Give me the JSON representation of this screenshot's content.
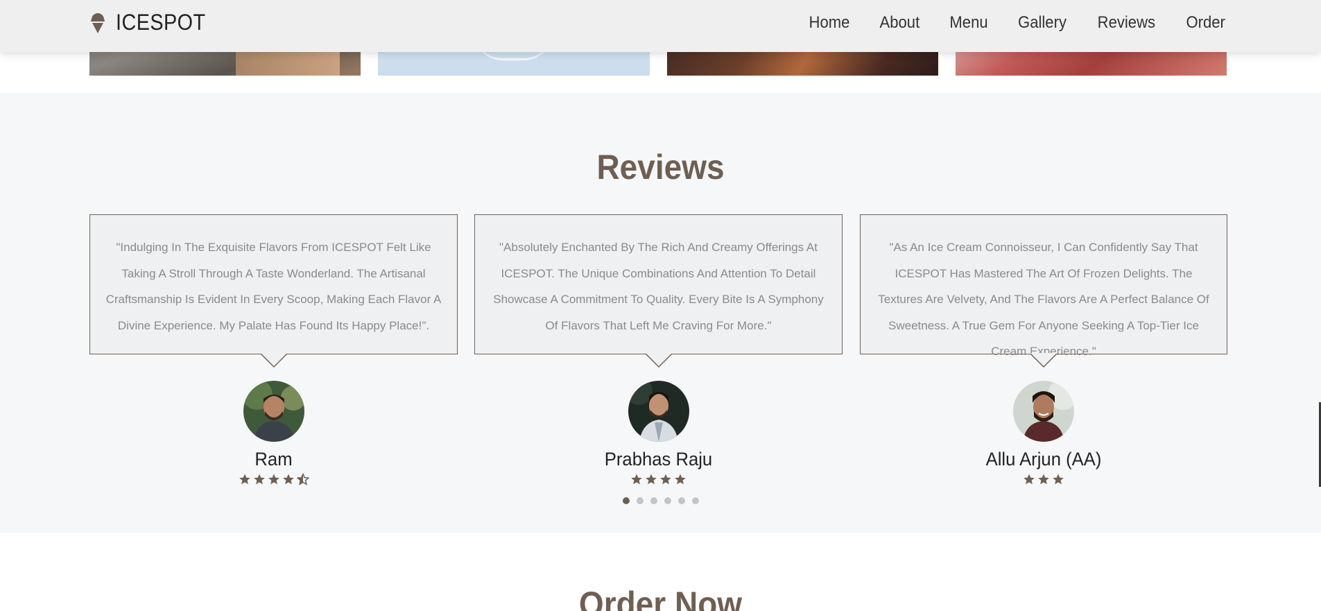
{
  "brand": {
    "name": "ICESPOT",
    "logo_icon": "ice-cream-icon"
  },
  "nav": {
    "items": [
      {
        "label": "Home"
      },
      {
        "label": "About"
      },
      {
        "label": "Menu"
      },
      {
        "label": "Gallery"
      },
      {
        "label": "Reviews"
      },
      {
        "label": "Order"
      }
    ]
  },
  "reviews": {
    "title": "Reviews",
    "items": [
      {
        "text": "\"Indulging In The Exquisite Flavors From ICESPOT Felt Like Taking A Stroll Through A Taste Wonderland. The Artisanal Craftsmanship Is Evident In Every Scoop, Making Each Flavor A Divine Experience. My Palate Has Found Its Happy Place!\".",
        "name": "Ram",
        "rating": 4.5
      },
      {
        "text": "\"Absolutely Enchanted By The Rich And Creamy Offerings At ICESPOT. The Unique Combinations And Attention To Detail Showcase A Commitment To Quality. Every Bite Is A Symphony Of Flavors That Left Me Craving For More.\"",
        "name": "Prabhas Raju",
        "rating": 4
      },
      {
        "text": "\"As An Ice Cream Connoisseur, I Can Confidently Say That ICESPOT Has Mastered The Art Of Frozen Delights. The Textures Are Velvety, And The Flavors Are A Perfect Balance Of Sweetness. A True Gem For Anyone Seeking A Top-Tier Ice Cream Experience.\"",
        "name": "Allu Arjun (AA)",
        "rating": 3
      }
    ],
    "pagination": {
      "count": 6,
      "active": 0
    }
  },
  "order": {
    "title": "Order Now"
  },
  "colors": {
    "accent": "#6e5f53",
    "bubble_bg": "#eff0f1",
    "section_bg": "#f6f7f9"
  }
}
